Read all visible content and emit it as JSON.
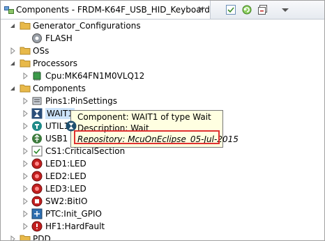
{
  "view": {
    "title": "Components - FRDM-K64F_USB_HID_Keyboard",
    "close_glyph": "✕",
    "toolbar": [
      "filter-icon",
      "refresh-icon",
      "collapse-all-icon",
      "view-menu-icon"
    ]
  },
  "tree": {
    "generator_configurations": {
      "label": "Generator_Configurations",
      "children": {
        "flash": "FLASH"
      }
    },
    "oss": {
      "label": "OSs"
    },
    "processors": {
      "label": "Processors",
      "children": {
        "cpu": "Cpu:MK64FN1M0VLQ12"
      }
    },
    "components": {
      "label": "Components",
      "children": {
        "pins1": "Pins1:PinSettings",
        "wait1": "WAIT1",
        "util1": "UTIL1",
        "usb1": "USB1",
        "cs1": "CS1:CriticalSection",
        "led1": "LED1:LED",
        "led2": "LED2:LED",
        "led3": "LED3:LED",
        "sw2": "SW2:BitIO",
        "ptc": "PTC:Init_GPIO",
        "hf1": "HF1:HardFault"
      }
    },
    "pdd": {
      "label": "PDD"
    }
  },
  "tooltip": {
    "line1": "Component: WAIT1 of type Wait",
    "line2": "Description: Wait",
    "line3": "Repository: McuOnEclipse_05-Jul-2015"
  },
  "colors": {
    "folder": "#e8b94a",
    "highlight": "#e03030",
    "tooltip_bg": "#ffffe1"
  }
}
